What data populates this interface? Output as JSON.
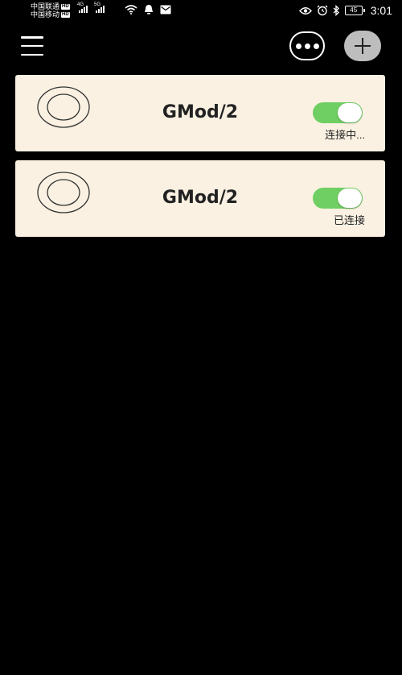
{
  "status_bar": {
    "carrier_1": "中国联通",
    "carrier_2": "中国移动",
    "hd_badge": "HD",
    "network_1": "4G",
    "network_2": "5G",
    "battery": "45",
    "time": "3:01",
    "icons": [
      "wifi-icon",
      "qq-bell-icon",
      "mail-icon",
      "eye-icon",
      "alarm-icon",
      "bluetooth-icon",
      "battery-icon"
    ]
  },
  "header": {
    "icons": [
      "menu-icon",
      "more-icon",
      "add-icon"
    ]
  },
  "devices": [
    {
      "name": "GMod/2",
      "status": "连接中...",
      "enabled": true
    },
    {
      "name": "GMod/2",
      "status": "已连接",
      "enabled": true
    }
  ],
  "colors": {
    "background": "#000000",
    "card": "#faf1e2",
    "toggle_on": "#6fcf62",
    "add_button": "#bdbdbd"
  }
}
